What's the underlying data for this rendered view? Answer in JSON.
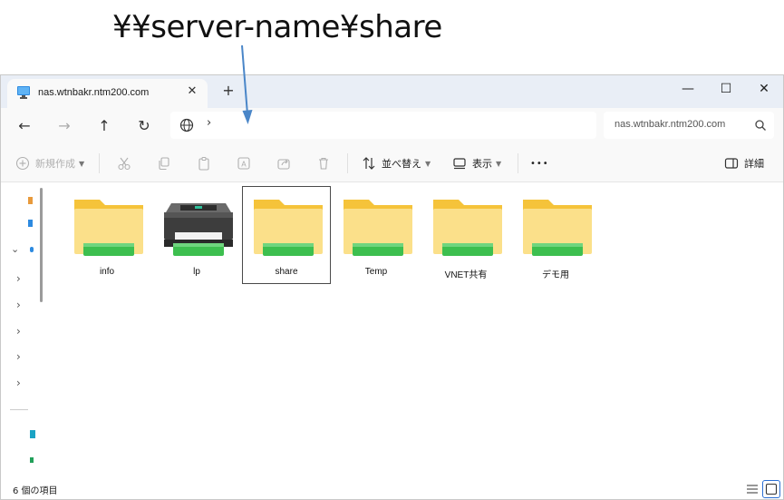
{
  "annotation": {
    "text": "¥¥server-name¥share"
  },
  "tab": {
    "title": "nas.wtnbakr.ntm200.com",
    "close": "✕",
    "new": "+"
  },
  "window_controls": {
    "minimize": "—",
    "maximize": "☐",
    "close": "✕"
  },
  "nav": {
    "back": "←",
    "forward": "→",
    "up": "↑",
    "refresh": "↻",
    "chevron": "›"
  },
  "search": {
    "text": "nas.wtnbakr.ntm200.com"
  },
  "toolbar": {
    "new_label": "新規作成",
    "sort_label": "並べ替え",
    "view_label": "表示",
    "more_label": "•••",
    "details_label": "詳細"
  },
  "items": [
    {
      "label": "info",
      "type": "folder"
    },
    {
      "label": "lp",
      "type": "printer"
    },
    {
      "label": "share",
      "type": "folder",
      "selected": true
    },
    {
      "label": "Temp",
      "type": "folder"
    },
    {
      "label": "VNET共有",
      "type": "folder"
    },
    {
      "label": "デモ用",
      "type": "folder"
    }
  ],
  "status": {
    "count": "6 個の項目"
  },
  "colors": {
    "folder_back": "#f5c33a",
    "folder_front": "#fbe08a",
    "share_bar": "#3dbf4f",
    "accent": "#2a6fd4",
    "arrow": "#4a86c8"
  }
}
